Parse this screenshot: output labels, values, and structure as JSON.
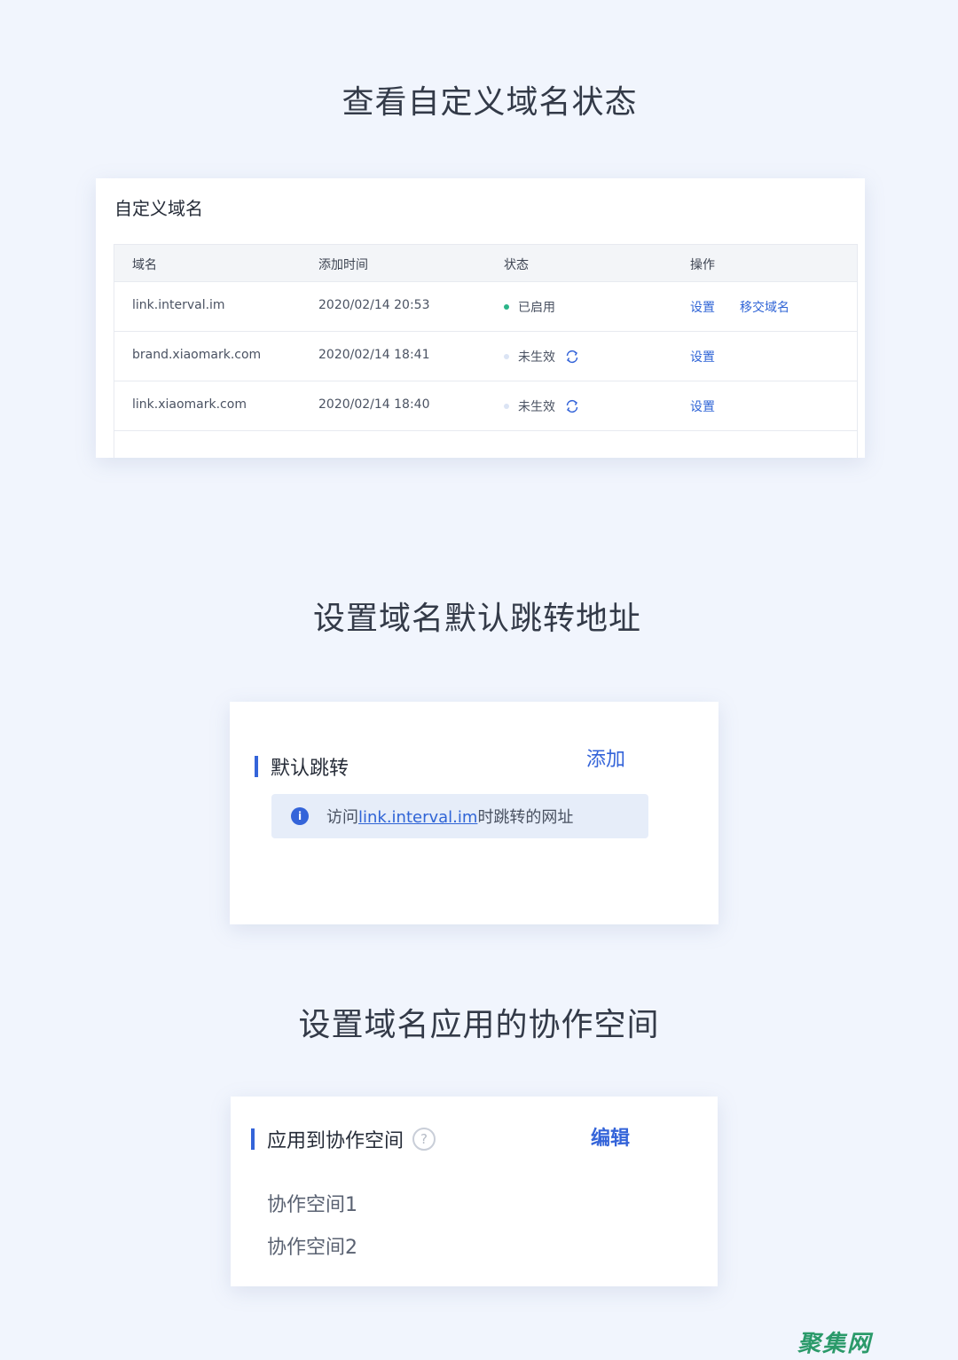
{
  "sections": {
    "status_title": "查看自定义域名状态",
    "redirect_title": "设置域名默认跳转地址",
    "workspace_title": "设置域名应用的协作空间"
  },
  "domains_card": {
    "heading": "自定义域名",
    "columns": [
      "域名",
      "添加时间",
      "状态",
      "操作"
    ],
    "rows": [
      {
        "domain": "link.interval.im",
        "added": "2020/02/14 20:53",
        "status": "已启用",
        "status_color": "#2bb488",
        "ops": [
          "设置",
          "移交域名"
        ]
      },
      {
        "domain": "brand.xiaomark.com",
        "added": "2020/02/14 18:41",
        "status": "未生效",
        "status_color": "#dbe4f4",
        "ops": [
          "设置"
        ]
      },
      {
        "domain": "link.xiaomark.com",
        "added": "2020/02/14 18:40",
        "status": "未生效",
        "status_color": "#dbe4f4",
        "ops": [
          "设置"
        ]
      }
    ]
  },
  "redirect_card": {
    "heading": "默认跳转",
    "add_label": "添加",
    "info_prefix": "访问",
    "info_link": "link.interval.im",
    "info_suffix": "时跳转的网址",
    "info_icon": "i"
  },
  "workspace_card": {
    "heading": "应用到协作空间",
    "help_icon": "?",
    "edit_label": "编辑",
    "items": [
      "协作空间1",
      "协作空间2"
    ]
  },
  "watermark": "聚集网",
  "colors": {
    "accent": "#3464d9",
    "background": "#f1f5fd",
    "enabled": "#2bb488"
  }
}
